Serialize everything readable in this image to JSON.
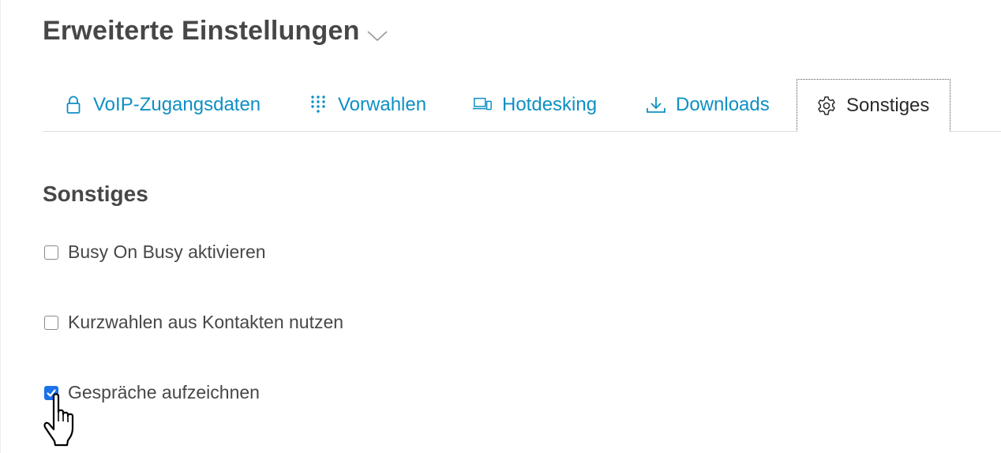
{
  "header": {
    "title": "Erweiterte Einstellungen",
    "chevron_icon": "chevron-down-icon"
  },
  "tabs": [
    {
      "label": "VoIP-Zugangsdaten",
      "icon": "lock-icon",
      "active": false
    },
    {
      "label": "Vorwahlen",
      "icon": "dialpad-icon",
      "active": false
    },
    {
      "label": "Hotdesking",
      "icon": "devices-icon",
      "active": false
    },
    {
      "label": "Downloads",
      "icon": "download-icon",
      "active": false
    },
    {
      "label": "Sonstiges",
      "icon": "gear-icon",
      "active": true
    }
  ],
  "section": {
    "title": "Sonstiges",
    "options": [
      {
        "label": "Busy On Busy aktivieren",
        "checked": false
      },
      {
        "label": "Kurzwahlen aus Kontakten nutzen",
        "checked": false
      },
      {
        "label": "Gespräche aufzeichnen",
        "checked": true
      }
    ]
  },
  "colors": {
    "link": "#0e8fc4",
    "checkbox_checked": "#1a73e8",
    "heading": "#474747"
  },
  "cursor": "hand-pointer-cursor"
}
